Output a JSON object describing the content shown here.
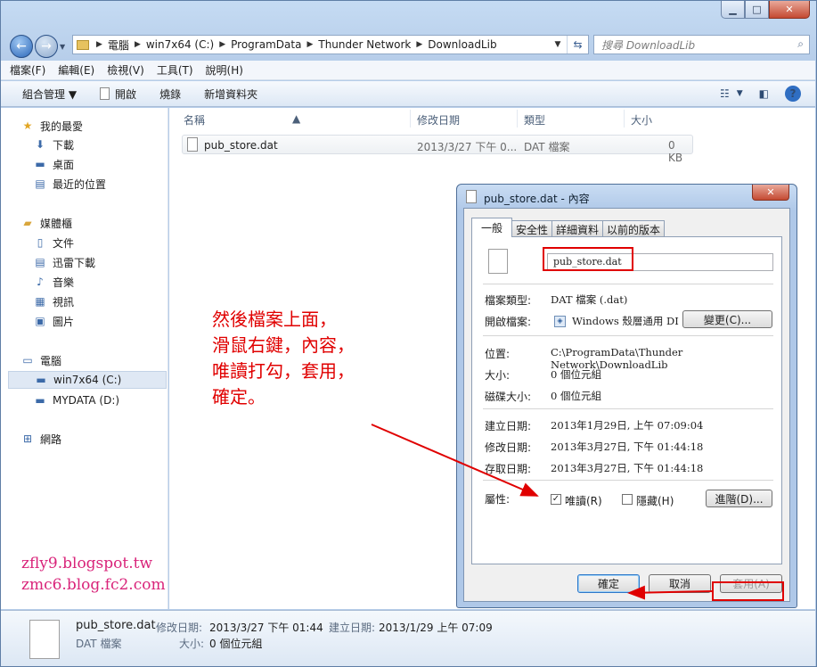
{
  "addressbar": {
    "path": [
      "電腦",
      "win7x64 (C:)",
      "ProgramData",
      "Thunder Network",
      "DownloadLib"
    ],
    "search_placeholder": "搜尋 DownloadLib"
  },
  "menubar": [
    "檔案(F)",
    "編輯(E)",
    "檢視(V)",
    "工具(T)",
    "說明(H)"
  ],
  "commandbar": {
    "organize": "組合管理 ▼",
    "open": "開啟",
    "burn": "燒錄",
    "new_folder": "新增資料夾"
  },
  "navpane": {
    "favorites": {
      "title": "我的最愛",
      "items": [
        "下載",
        "桌面",
        "最近的位置"
      ]
    },
    "libraries": {
      "title": "媒體櫃",
      "items": [
        "文件",
        "迅雷下載",
        "音樂",
        "視訊",
        "圖片"
      ]
    },
    "computer": {
      "title": "電腦",
      "items": [
        "win7x64 (C:)",
        "MYDATA (D:)"
      ]
    },
    "network": "網路"
  },
  "filelist": {
    "columns": [
      "名稱",
      "修改日期",
      "類型",
      "大小"
    ],
    "rows": [
      {
        "name": "pub_store.dat",
        "modified": "2013/3/27 下午 0...",
        "type": "DAT 檔案",
        "size": "0 KB"
      }
    ]
  },
  "details": {
    "name": "pub_store.dat",
    "type": "DAT 檔案",
    "modified_label": "修改日期:",
    "modified": "2013/3/27 下午 01:44",
    "created_label": "建立日期:",
    "created": "2013/1/29 上午 07:09",
    "size_label": "大小:",
    "size": "0 個位元組"
  },
  "watermark": [
    "zfly9.blogspot.tw",
    "zmc6.blog.fc2.com"
  ],
  "annotation": "然後檔案上面，\n滑鼠右鍵，內容，\n唯讀打勾，套用，\n確定。",
  "dialog": {
    "title": "pub_store.dat - 內容",
    "close": "✕",
    "tabs": [
      "一般",
      "安全性",
      "詳細資料",
      "以前的版本"
    ],
    "filename": "pub_store.dat",
    "file_type": {
      "label": "檔案類型:",
      "value": "DAT 檔案 (.dat)"
    },
    "opens_with": {
      "label": "開啟檔案:",
      "value": "Windows 殼層通用 DI",
      "button": "變更(C)..."
    },
    "location": {
      "label": "位置:",
      "value": "C:\\ProgramData\\Thunder Network\\DownloadLib"
    },
    "size": {
      "label": "大小:",
      "value": "0 個位元組"
    },
    "size_on_disk": {
      "label": "磁碟大小:",
      "value": "0 個位元組"
    },
    "created": {
      "label": "建立日期:",
      "value": "2013年1月29日, 上午 07:09:04"
    },
    "modified": {
      "label": "修改日期:",
      "value": "2013年3月27日, 下午 01:44:18"
    },
    "accessed": {
      "label": "存取日期:",
      "value": "2013年3月27日, 下午 01:44:18"
    },
    "attributes": {
      "label": "屬性:",
      "readonly": "唯讀(R)",
      "hidden": "隱藏(H)",
      "advanced": "進階(D)..."
    },
    "buttons": {
      "ok": "確定",
      "cancel": "取消",
      "apply": "套用(A)"
    }
  }
}
